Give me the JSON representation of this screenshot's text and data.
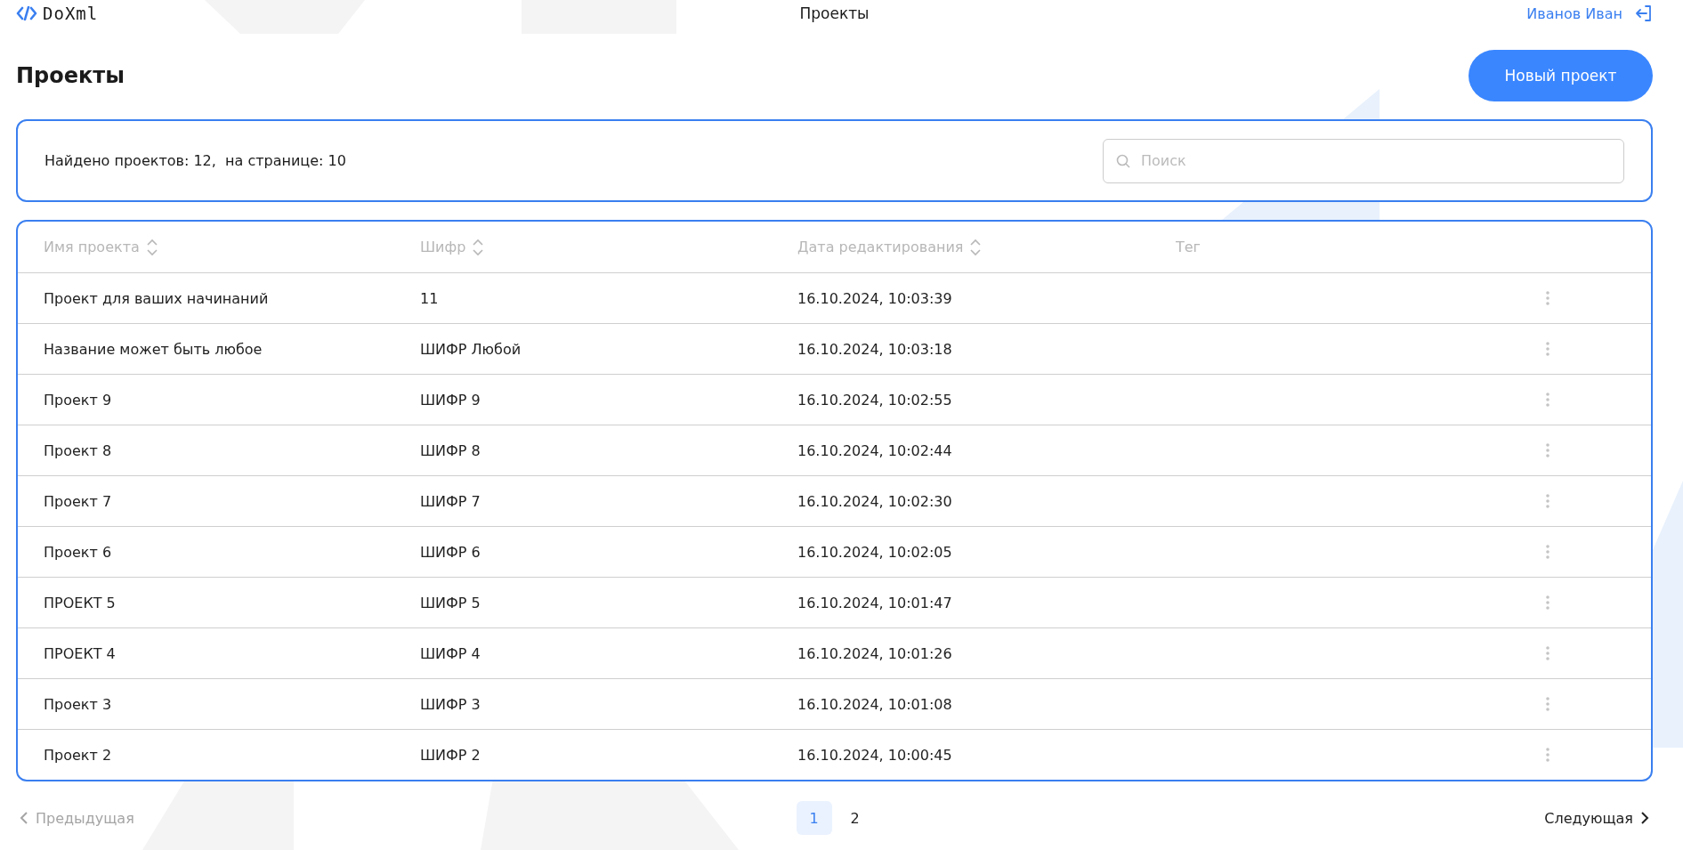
{
  "header": {
    "logo": "DoXml",
    "title": "Проекты",
    "user": "Иванов Иван"
  },
  "page": {
    "title": "Проекты",
    "new_button": "Новый проект"
  },
  "filter": {
    "summary": "Найдено проектов: 12,  на странице: 10",
    "search": {
      "placeholder": "Поиск"
    }
  },
  "table": {
    "columns": [
      {
        "label": "Имя проекта",
        "sortable": true
      },
      {
        "label": "Шифр",
        "sortable": true
      },
      {
        "label": "Дата редактирования",
        "sortable": true
      },
      {
        "label": "Тег",
        "sortable": false
      }
    ],
    "rows": [
      {
        "name": "Проект для ваших начинаний",
        "code": "11",
        "date": "16.10.2024, 10:03:39"
      },
      {
        "name": "Название может быть любое",
        "code": "ШИФР Любой",
        "date": "16.10.2024, 10:03:18"
      },
      {
        "name": "Проект 9",
        "code": "ШИФР 9",
        "date": "16.10.2024, 10:02:55"
      },
      {
        "name": "Проект 8",
        "code": "ШИФР 8",
        "date": "16.10.2024, 10:02:44"
      },
      {
        "name": "Проект 7",
        "code": "ШИФР 7",
        "date": "16.10.2024, 10:02:30"
      },
      {
        "name": "Проект 6",
        "code": "ШИФР 6",
        "date": "16.10.2024, 10:02:05"
      },
      {
        "name": "ПРОЕКТ 5",
        "code": "ШИФР 5",
        "date": "16.10.2024, 10:01:47"
      },
      {
        "name": "ПРОЕКТ 4",
        "code": "ШИФР 4",
        "date": "16.10.2024, 10:01:26"
      },
      {
        "name": "Проект 3",
        "code": "ШИФР 3",
        "date": "16.10.2024, 10:01:08"
      },
      {
        "name": "Проект 2",
        "code": "ШИФР 2",
        "date": "16.10.2024, 10:00:45"
      }
    ]
  },
  "pagination": {
    "previous": {
      "label": "Предыдущая",
      "disabled": true
    },
    "pages": [
      {
        "label": "1",
        "selected": true
      },
      {
        "label": "2",
        "selected": false
      }
    ],
    "next": {
      "label": "Следующая",
      "disabled": false
    }
  }
}
